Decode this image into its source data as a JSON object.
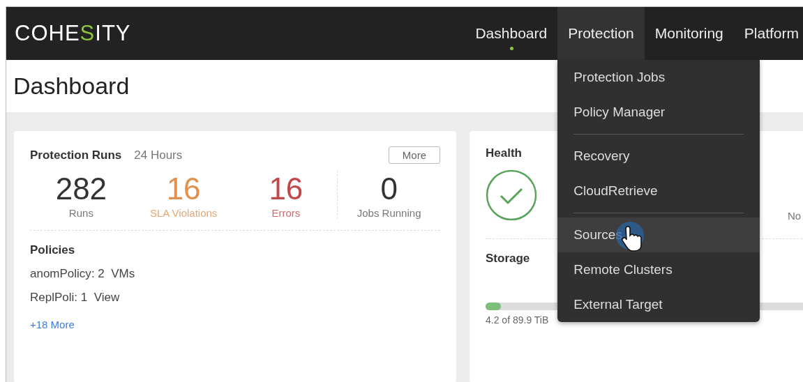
{
  "header": {
    "logo": {
      "before": "COHE",
      "accent": "S",
      "after": "ITY"
    },
    "nav": [
      {
        "label": "Dashboard",
        "selected": true,
        "expanded": false
      },
      {
        "label": "Protection",
        "selected": false,
        "expanded": true
      },
      {
        "label": "Monitoring",
        "selected": false,
        "expanded": false
      },
      {
        "label": "Platform",
        "selected": false,
        "expanded": false
      }
    ]
  },
  "menu": {
    "groups": [
      {
        "items": [
          {
            "label": "Protection Jobs",
            "hovered": false
          },
          {
            "label": "Policy Manager",
            "hovered": false
          }
        ]
      },
      {
        "items": [
          {
            "label": "Recovery",
            "hovered": false
          },
          {
            "label": "CloudRetrieve",
            "hovered": false
          }
        ]
      },
      {
        "items": [
          {
            "label": "Sources",
            "hovered": true
          },
          {
            "label": "Remote Clusters",
            "hovered": false
          },
          {
            "label": "External Target",
            "hovered": false
          }
        ]
      }
    ]
  },
  "page_title": "Dashboard",
  "protection_runs": {
    "title": "Protection Runs",
    "period": "24 Hours",
    "more_button": "More",
    "stats": [
      {
        "value": "282",
        "label": "Runs",
        "color": "#333333",
        "separated": false
      },
      {
        "value": "16",
        "label": "SLA Violations",
        "color": "#e0914f",
        "separated": false
      },
      {
        "value": "16",
        "label": "Errors",
        "color": "#c0474a",
        "separated": false
      },
      {
        "value": "0",
        "label": "Jobs Running",
        "color": "#333333",
        "separated": true
      }
    ],
    "policies_title": "Policies",
    "policies": [
      {
        "name": "anomPolicy",
        "sep": ":",
        "count": "2",
        "unit": "VMs"
      },
      {
        "name": "ReplPoli",
        "sep": ":",
        "count": "1",
        "unit": "View"
      }
    ],
    "more_link": "+18 More"
  },
  "health": {
    "title": "Health",
    "healthy": true,
    "stat": {
      "label": "No"
    }
  },
  "storage": {
    "title": "Storage",
    "level": 0.047,
    "reading": "4.2 of 89.9 TiB"
  }
}
